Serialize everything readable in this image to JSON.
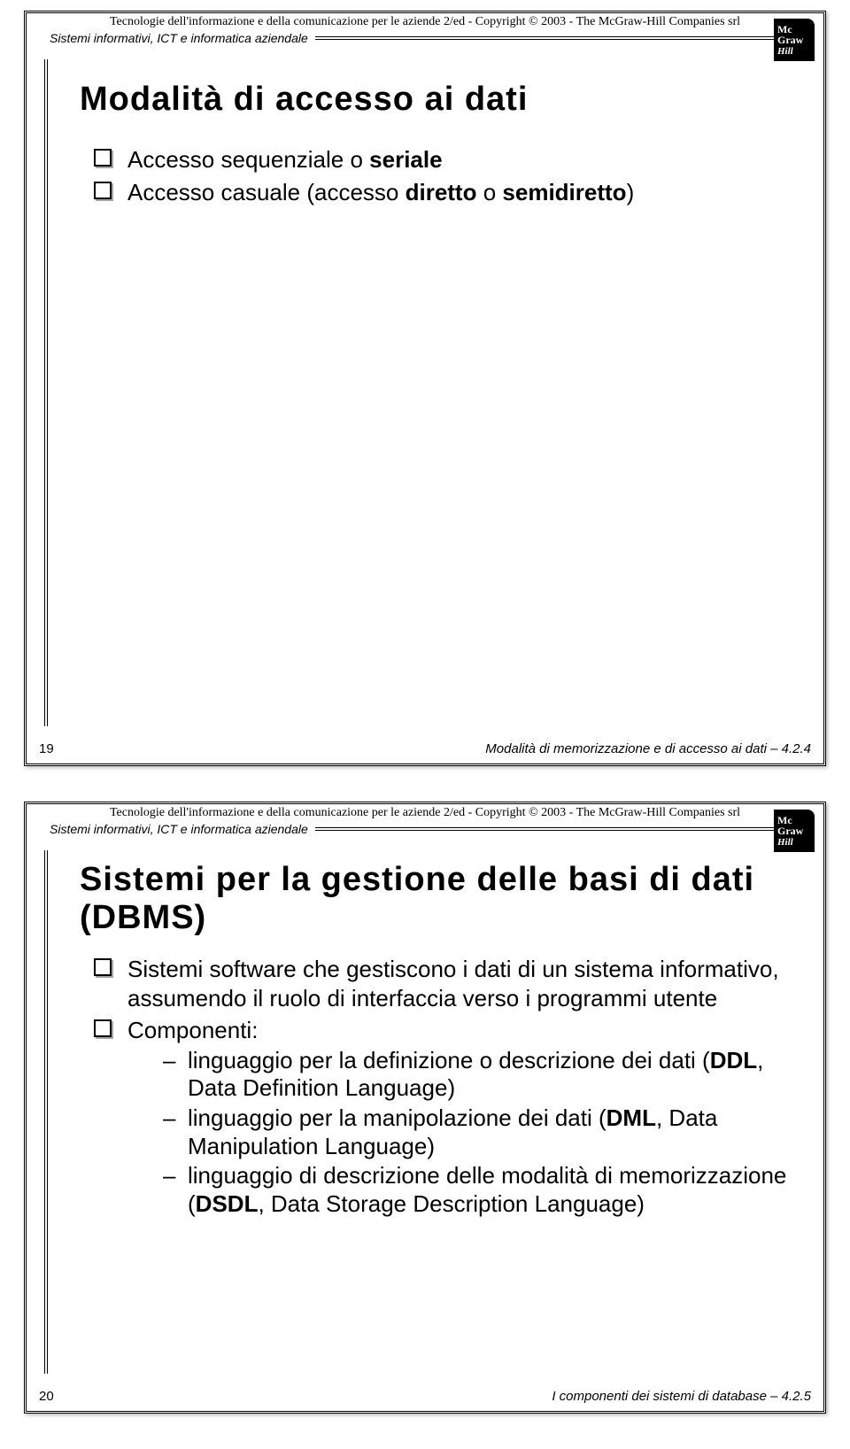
{
  "common": {
    "copyright": "Tecnologie dell'informazione e della comunicazione per le aziende 2/ed - Copyright © 2003 - The McGraw-Hill Companies srl",
    "subtitle": "Sistemi informativi, ICT e informatica aziendale",
    "logo_line1": "Mc",
    "logo_line2": "Graw",
    "logo_line3": "Hill"
  },
  "slide1": {
    "title": "Modalità di accesso ai dati",
    "bullets": [
      {
        "pre": "Accesso sequenziale o ",
        "bold": "seriale",
        "post": ""
      },
      {
        "pre": "Accesso casuale (accesso ",
        "bold": "diretto",
        "post": " o ",
        "bold2": "semidiretto",
        "post2": ")"
      }
    ],
    "footer_left": "19",
    "footer_right": "Modalità di memorizzazione e di accesso ai dati – 4.2.4"
  },
  "slide2": {
    "title": "Sistemi per la gestione delle basi di dati (DBMS)",
    "bullet1": "Sistemi software che gestiscono i dati di un sistema informativo, assumendo il ruolo di interfaccia verso i programmi utente",
    "bullet2": "Componenti:",
    "dashes": [
      {
        "pre": "linguaggio per la definizione o descrizione dei dati (",
        "bold": "DDL",
        "post": ", Data Definition Language)"
      },
      {
        "pre": "linguaggio per la manipolazione dei dati (",
        "bold": "DML",
        "post": ", Data Manipulation Language)"
      },
      {
        "pre": "linguaggio di descrizione delle modalità di memorizzazione (",
        "bold": "DSDL",
        "post": ", Data Storage Description Language)"
      }
    ],
    "footer_left": "20",
    "footer_right": "I componenti dei sistemi di database – 4.2.5"
  }
}
